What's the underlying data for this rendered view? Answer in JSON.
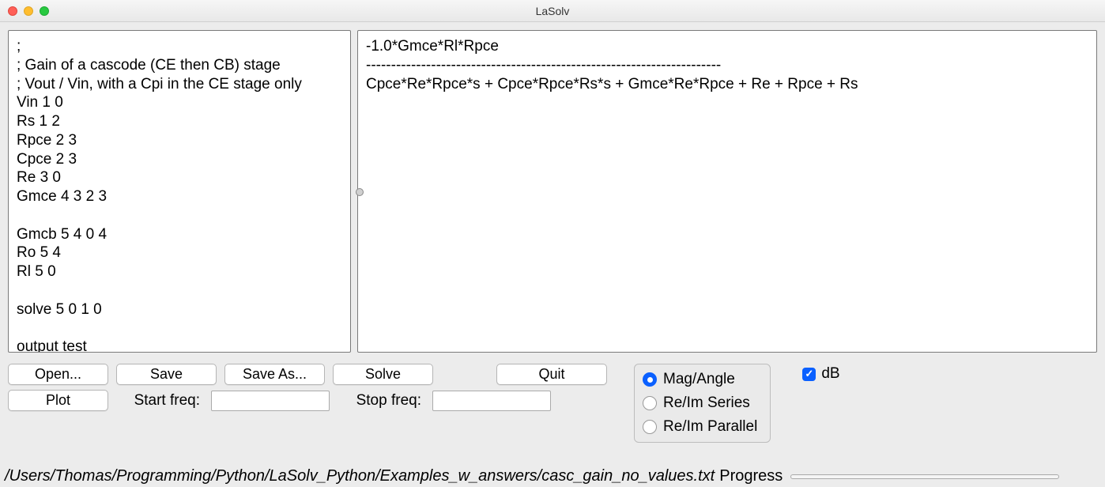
{
  "window": {
    "title": "LaSolv"
  },
  "input_text": ";\n; Gain of a cascode (CE then CB) stage\n; Vout / Vin, with a Cpi in the CE stage only\nVin 1 0\nRs 1 2\nRpce 2 3\nCpce 2 3\nRe 3 0\nGmce 4 3 2 3\n\nGmcb 5 4 0 4\nRo 5 4\nRl 5 0\n\nsolve 5 0 1 0\n\noutput test",
  "output_text": "-1.0*Gmce*Rl*Rpce\n-----------------------------------------------------------------------\nCpce*Re*Rpce*s + Cpce*Rpce*Rs*s + Gmce*Re*Rpce + Re + Rpce + Rs",
  "buttons": {
    "open": "Open...",
    "save": "Save",
    "saveas": "Save As...",
    "solve": "Solve",
    "quit": "Quit",
    "plot": "Plot"
  },
  "labels": {
    "start_freq": "Start freq:",
    "stop_freq": "Stop freq:"
  },
  "inputs": {
    "start_freq": "",
    "stop_freq": ""
  },
  "radios": {
    "mag_angle": "Mag/Angle",
    "reim_series": "Re/Im Series",
    "reim_parallel": "Re/Im Parallel",
    "selected": "mag_angle"
  },
  "checkbox": {
    "db_label": "dB",
    "db_checked": true
  },
  "status": {
    "path": "/Users/Thomas/Programming/Python/LaSolv_Python/Examples_w_answers/casc_gain_no_values.txt",
    "progress_label": "Progress"
  }
}
